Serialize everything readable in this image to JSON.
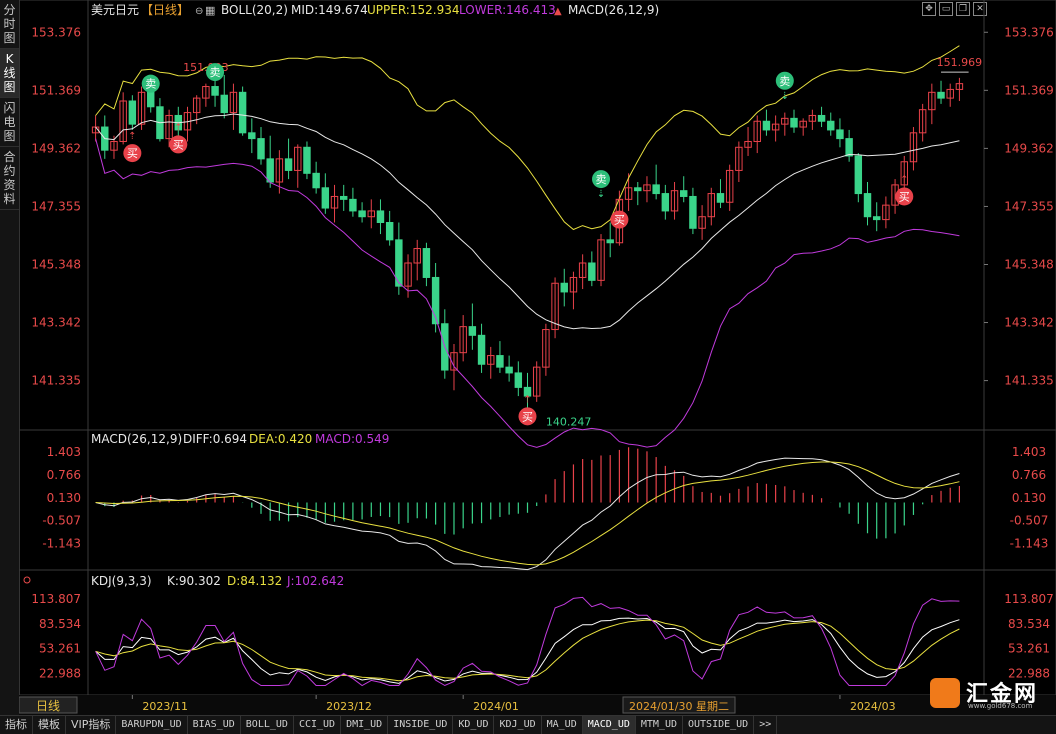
{
  "left_tabs": [
    "分时图",
    "K线图",
    "闪电图",
    "合约资料"
  ],
  "left_tab_active": 1,
  "main_header": {
    "symbol": "美元日元",
    "period": "【日线】",
    "boll_label": "BOLL(20,2)",
    "mid": "MID:149.674",
    "upper": "UPPER:152.934",
    "lower": "LOWER:146.413",
    "macd_label": "MACD(26,12,9)"
  },
  "price_axis": [
    "153.376",
    "151.369",
    "149.362",
    "147.355",
    "145.348",
    "143.342",
    "141.335"
  ],
  "annotations": {
    "high_left": "151.903",
    "high_right": "151.969",
    "low": "140.247"
  },
  "signals": {
    "buy": "买",
    "sell": "卖"
  },
  "macd_header": {
    "label": "MACD(26,12,9)",
    "diff": "DIFF:0.694",
    "dea": "DEA:0.420",
    "macd": "MACD:0.549"
  },
  "macd_axis": [
    "1.403",
    "0.766",
    "0.130",
    "-0.507",
    "-1.143"
  ],
  "kdj_header": {
    "label": "KDJ(9,3,3)",
    "k": "K:90.302",
    "d": "D:84.132",
    "j": "J:102.642"
  },
  "kdj_axis": [
    "113.807",
    "83.534",
    "53.261",
    "22.988"
  ],
  "date_axis": {
    "period_label": "日线",
    "dates": [
      "2023/11",
      "2023/12",
      "2024/01",
      "2024/03"
    ],
    "cursor_date": "2024/01/30 星期二"
  },
  "bottom_tabs": [
    "指标",
    "模板",
    "VIP指标",
    "BARUPDN_UD",
    "BIAS_UD",
    "BOLL_UD",
    "CCI_UD",
    "DMI_UD",
    "INSIDE_UD",
    "KD_UD",
    "KDJ_UD",
    "MA_UD",
    "MACD_UD",
    "MTM_UD",
    "OUTSIDE_UD",
    ">>"
  ],
  "bottom_tab_active": 12,
  "logo": {
    "text": "汇金网",
    "url": "www.gold678.com"
  },
  "toolbar_icons": [
    "move-icon",
    "minus-icon",
    "restore-icon",
    "close-icon"
  ],
  "colors": {
    "up": "#e8424a",
    "down": "#3ad48a",
    "boll_mid": "#e8e8e8",
    "boll_upper": "#e8e040",
    "boll_lower": "#c03adc",
    "header_symbol": "#e8e8e8",
    "header_upper": "#e8e040",
    "header_lower": "#c03adc",
    "axis_text": "#e84a4a",
    "kdj_k": "#ffffff",
    "kdj_d": "#e8e040",
    "kdj_j": "#c03adc"
  },
  "chart_data": {
    "type": "candlestick",
    "title": "美元日元 日线",
    "y_range": [
      139.8,
      153.8
    ],
    "candles": [
      [
        149.9,
        150.5,
        149.6,
        150.1
      ],
      [
        150.1,
        150.5,
        149.0,
        149.3
      ],
      [
        149.3,
        149.8,
        149.0,
        149.6
      ],
      [
        149.6,
        151.3,
        149.5,
        151.0
      ],
      [
        151.0,
        151.2,
        150.0,
        150.2
      ],
      [
        150.2,
        151.5,
        150.0,
        151.3
      ],
      [
        151.3,
        151.9,
        150.6,
        150.8
      ],
      [
        150.8,
        151.1,
        149.6,
        149.7
      ],
      [
        149.7,
        150.7,
        149.4,
        150.5
      ],
      [
        150.5,
        150.8,
        149.8,
        150.0
      ],
      [
        150.0,
        150.8,
        149.6,
        150.6
      ],
      [
        150.6,
        151.2,
        150.2,
        151.1
      ],
      [
        151.1,
        151.6,
        150.8,
        151.5
      ],
      [
        151.5,
        151.9,
        150.8,
        151.2
      ],
      [
        151.2,
        151.9,
        150.4,
        150.6
      ],
      [
        150.6,
        151.6,
        150.0,
        151.3
      ],
      [
        151.3,
        151.5,
        149.8,
        149.9
      ],
      [
        149.9,
        150.4,
        149.2,
        149.7
      ],
      [
        149.7,
        150.1,
        148.8,
        149.0
      ],
      [
        149.0,
        149.8,
        148.0,
        148.2
      ],
      [
        148.2,
        149.3,
        147.8,
        149.0
      ],
      [
        149.0,
        149.7,
        148.3,
        148.6
      ],
      [
        148.6,
        149.5,
        148.0,
        149.4
      ],
      [
        149.4,
        149.6,
        148.3,
        148.5
      ],
      [
        148.5,
        148.9,
        147.8,
        148.0
      ],
      [
        148.0,
        148.5,
        147.1,
        147.3
      ],
      [
        147.3,
        148.1,
        146.8,
        147.7
      ],
      [
        147.7,
        148.1,
        147.2,
        147.6
      ],
      [
        147.6,
        148.0,
        147.0,
        147.2
      ],
      [
        147.2,
        147.5,
        146.8,
        147.0
      ],
      [
        147.0,
        147.6,
        146.6,
        147.2
      ],
      [
        147.2,
        147.6,
        146.4,
        146.8
      ],
      [
        146.8,
        147.2,
        146.0,
        146.2
      ],
      [
        146.2,
        146.8,
        144.3,
        144.6
      ],
      [
        144.6,
        145.7,
        144.2,
        145.4
      ],
      [
        145.4,
        146.2,
        144.8,
        145.9
      ],
      [
        145.9,
        146.1,
        144.6,
        144.9
      ],
      [
        144.9,
        145.4,
        143.0,
        143.3
      ],
      [
        143.3,
        143.8,
        141.4,
        141.7
      ],
      [
        141.7,
        142.6,
        141.0,
        142.3
      ],
      [
        142.3,
        143.6,
        142.0,
        143.2
      ],
      [
        143.2,
        144.0,
        142.4,
        142.9
      ],
      [
        142.9,
        143.3,
        141.6,
        141.9
      ],
      [
        141.9,
        142.5,
        141.4,
        142.2
      ],
      [
        142.2,
        142.7,
        141.6,
        141.8
      ],
      [
        141.8,
        142.2,
        141.3,
        141.6
      ],
      [
        141.6,
        142.0,
        140.8,
        141.1
      ],
      [
        141.1,
        141.6,
        140.2,
        140.8
      ],
      [
        140.8,
        142.0,
        140.6,
        141.8
      ],
      [
        141.8,
        143.3,
        141.5,
        143.1
      ],
      [
        143.1,
        144.9,
        142.8,
        144.7
      ],
      [
        144.7,
        145.2,
        143.9,
        144.4
      ],
      [
        144.4,
        145.1,
        143.8,
        144.9
      ],
      [
        144.9,
        145.7,
        144.5,
        145.4
      ],
      [
        145.4,
        145.8,
        144.6,
        144.8
      ],
      [
        144.8,
        146.4,
        144.6,
        146.2
      ],
      [
        146.2,
        146.8,
        145.6,
        146.1
      ],
      [
        146.1,
        147.9,
        146.0,
        147.6
      ],
      [
        147.6,
        148.5,
        147.2,
        148.0
      ],
      [
        148.0,
        148.2,
        147.4,
        147.9
      ],
      [
        147.9,
        148.4,
        147.5,
        148.1
      ],
      [
        148.1,
        148.8,
        147.6,
        147.8
      ],
      [
        147.8,
        148.1,
        146.9,
        147.2
      ],
      [
        147.2,
        148.2,
        146.9,
        147.9
      ],
      [
        147.9,
        148.4,
        147.5,
        147.7
      ],
      [
        147.7,
        148.0,
        146.4,
        146.6
      ],
      [
        146.6,
        147.4,
        146.2,
        147.0
      ],
      [
        147.0,
        148.0,
        146.7,
        147.8
      ],
      [
        147.8,
        148.3,
        147.3,
        147.5
      ],
      [
        147.5,
        148.8,
        147.2,
        148.6
      ],
      [
        148.6,
        149.6,
        148.2,
        149.4
      ],
      [
        149.4,
        150.1,
        149.1,
        149.6
      ],
      [
        149.6,
        150.5,
        149.2,
        150.3
      ],
      [
        150.3,
        150.7,
        149.8,
        150.0
      ],
      [
        150.0,
        150.5,
        149.6,
        150.2
      ],
      [
        150.2,
        150.6,
        149.8,
        150.4
      ],
      [
        150.4,
        150.7,
        149.9,
        150.1
      ],
      [
        150.1,
        150.4,
        149.8,
        150.3
      ],
      [
        150.3,
        150.7,
        150.0,
        150.5
      ],
      [
        150.5,
        150.8,
        150.1,
        150.3
      ],
      [
        150.3,
        150.6,
        149.8,
        150.0
      ],
      [
        150.0,
        150.4,
        149.4,
        149.7
      ],
      [
        149.7,
        150.0,
        148.9,
        149.1
      ],
      [
        149.1,
        149.2,
        147.5,
        147.8
      ],
      [
        147.8,
        148.2,
        146.7,
        147.0
      ],
      [
        147.0,
        147.5,
        146.5,
        146.9
      ],
      [
        146.9,
        147.7,
        146.6,
        147.4
      ],
      [
        147.4,
        148.3,
        147.1,
        148.1
      ],
      [
        148.1,
        149.1,
        147.8,
        148.9
      ],
      [
        148.9,
        150.1,
        148.6,
        149.9
      ],
      [
        149.9,
        150.9,
        149.6,
        150.7
      ],
      [
        150.7,
        151.6,
        150.2,
        151.3
      ],
      [
        151.3,
        151.7,
        150.9,
        151.1
      ],
      [
        151.1,
        151.6,
        150.8,
        151.4
      ],
      [
        151.4,
        151.8,
        151.0,
        151.6
      ]
    ]
  }
}
